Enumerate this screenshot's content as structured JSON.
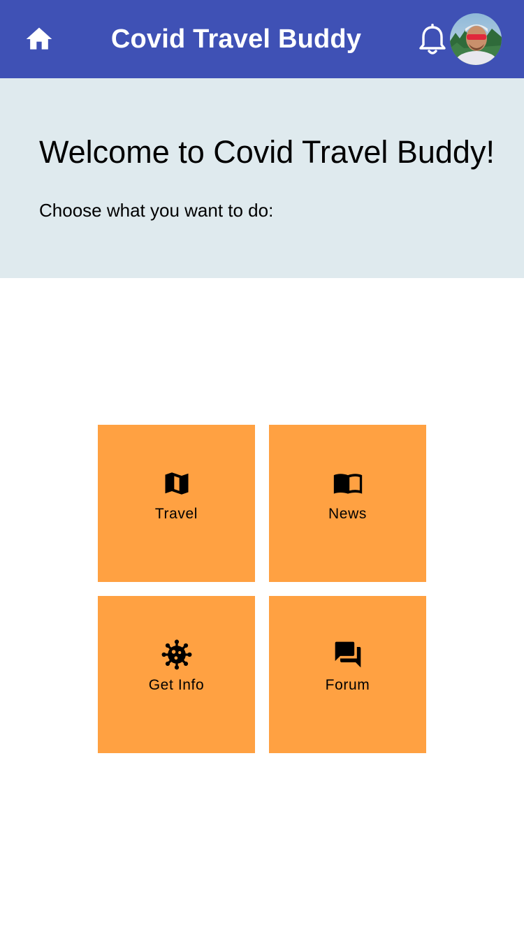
{
  "appbar": {
    "title": "Covid Travel Buddy",
    "home_icon": "home-icon",
    "notification_icon": "bell-outline-icon",
    "avatar": "user-avatar-photo",
    "background_color": "#3f51b5"
  },
  "welcome": {
    "title": "Welcome to Covid Travel Buddy!",
    "subtitle": "Choose what you want to do:",
    "background_color": "#dfeaee"
  },
  "menu": {
    "tile_color": "#ffa142",
    "tiles": [
      {
        "label": "Travel",
        "icon": "map-icon"
      },
      {
        "label": "News",
        "icon": "book-open-icon"
      },
      {
        "label": "Get Info",
        "icon": "virus-icon"
      },
      {
        "label": "Forum",
        "icon": "forum-icon"
      }
    ]
  }
}
